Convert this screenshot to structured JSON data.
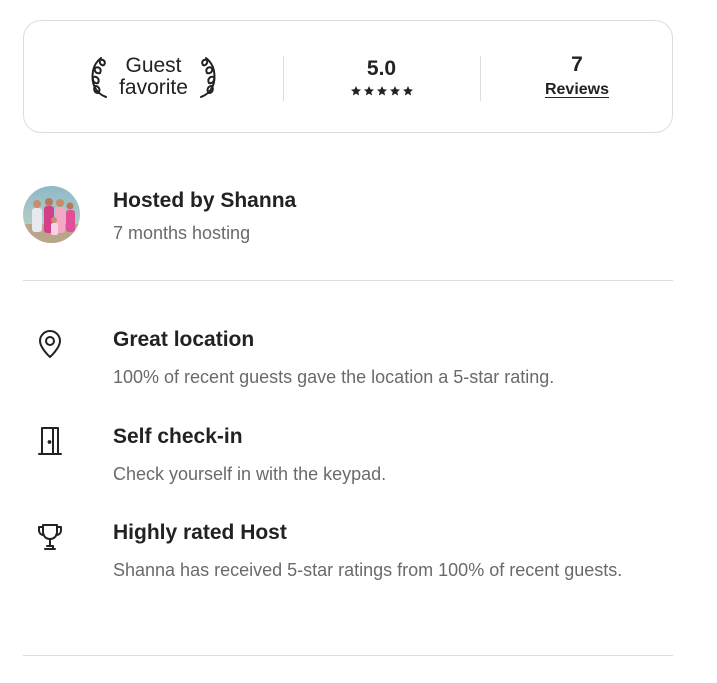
{
  "guest_favorite": {
    "line1": "Guest",
    "line2": "favorite"
  },
  "rating": {
    "value": "5.0",
    "stars": 5
  },
  "reviews": {
    "count": "7",
    "label": "Reviews"
  },
  "host": {
    "title": "Hosted by Shanna",
    "subtitle": "7 months hosting"
  },
  "highlights": [
    {
      "icon": "location-pin-icon",
      "title": "Great location",
      "description": "100% of recent guests gave the location a 5-star rating."
    },
    {
      "icon": "door-icon",
      "title": "Self check-in",
      "description": "Check yourself in with the keypad."
    },
    {
      "icon": "trophy-icon",
      "title": "Highly rated Host",
      "description": "Shanna has received 5-star ratings from 100% of recent guests."
    }
  ],
  "colors": {
    "text_primary": "#222222",
    "text_secondary": "#6a6a6a",
    "border": "#dddddd"
  }
}
